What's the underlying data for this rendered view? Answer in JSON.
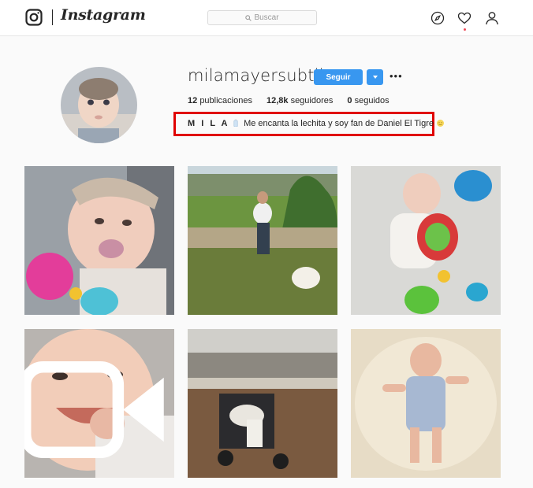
{
  "header": {
    "logo_text": "Instagram",
    "search_placeholder": "Buscar",
    "icons": [
      "instagram-glyph-icon",
      "search-icon",
      "compass-icon",
      "heart-icon",
      "user-icon"
    ]
  },
  "profile": {
    "username": "milamayersubtil",
    "follow_label": "Seguir",
    "more_label": "•••",
    "stats": {
      "posts_count": "12",
      "posts_label": "publicaciones",
      "followers_count": "12,8k",
      "followers_label": "seguidores",
      "following_count": "0",
      "following_label": "seguidos"
    },
    "bio_name": "M I L A",
    "bio_text": "Me encanta la lechita y soy fan de Daniel El Tigre",
    "bio_emojis": [
      "baby-bottle-icon",
      "sun-face-icon"
    ]
  },
  "colors": {
    "accent": "#3897f0",
    "highlight_box": "#e00000",
    "notification": "#ed4956"
  },
  "posts": [
    {
      "type": "photo",
      "subject": "baby with pacifier and toy"
    },
    {
      "type": "photo",
      "subject": "girl holding baby in garden with dog"
    },
    {
      "type": "photo",
      "subject": "baby lying with toys"
    },
    {
      "type": "video",
      "subject": "smiling baby close-up"
    },
    {
      "type": "photo",
      "subject": "stroller on rooftop terrace"
    },
    {
      "type": "photo",
      "subject": "baby on sheepskin rug"
    }
  ]
}
